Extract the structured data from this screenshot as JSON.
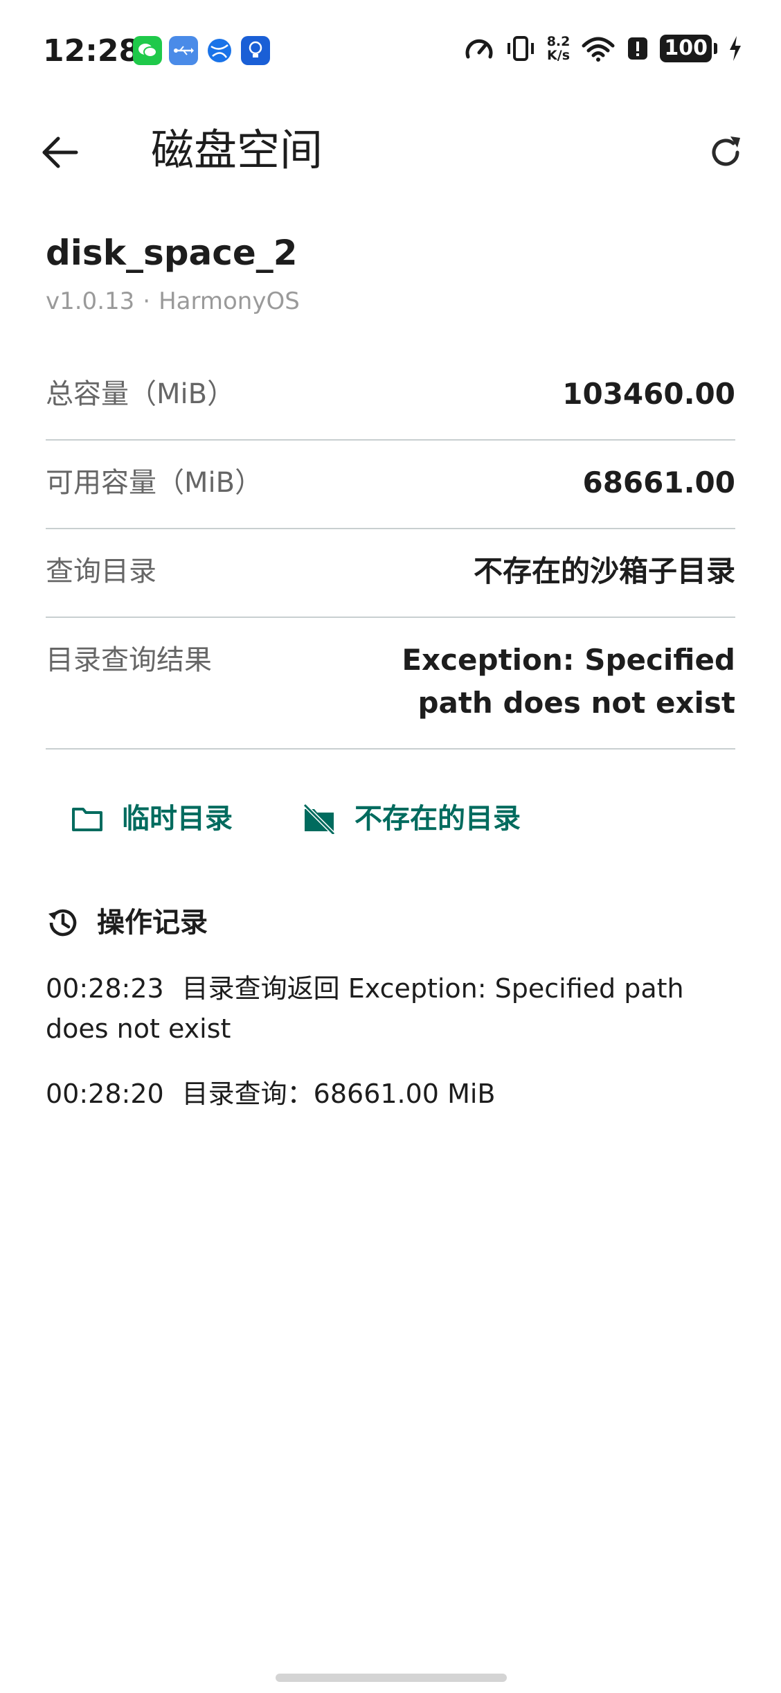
{
  "status_bar": {
    "time": "12:28",
    "notifications": [
      "wechat-icon",
      "usb-icon",
      "browser-icon",
      "lightbulb-icon"
    ],
    "net_speed_value": "8.2",
    "net_speed_unit": "K/s",
    "battery": "100",
    "icons": [
      "speedometer-icon",
      "vibrate-icon",
      "wifi-icon",
      "alert-icon",
      "charging-bolt-icon"
    ]
  },
  "app_bar": {
    "title": "磁盘空间",
    "back_icon": "arrow-left-icon",
    "refresh_icon": "refresh-icon"
  },
  "package": {
    "name": "disk_space_2",
    "version": "v1.0.13",
    "separator": "·",
    "platform": "HarmonyOS"
  },
  "info_rows": [
    {
      "label": "总容量（MiB）",
      "value": "103460.00"
    },
    {
      "label": "可用容量（MiB）",
      "value": "68661.00"
    },
    {
      "label": "查询目录",
      "value": "不存在的沙箱子目录"
    },
    {
      "label": "目录查询结果",
      "value": "Exception: Specified path does not exist"
    }
  ],
  "actions": [
    {
      "label": "临时目录",
      "icon": "folder-icon"
    },
    {
      "label": "不存在的目录",
      "icon": "folder-off-icon"
    }
  ],
  "log": {
    "title": "操作记录",
    "icon": "history-icon",
    "entries": [
      {
        "time": "00:28:23",
        "text": "目录查询返回 Exception: Specified path does not exist"
      },
      {
        "time": "00:28:20",
        "text": "目录查询：68661.00 MiB"
      }
    ]
  },
  "colors": {
    "accent": "#006b5e",
    "divider": "#c8cfd0",
    "secondary_text": "#9a9a9a",
    "label_text": "#666666"
  }
}
